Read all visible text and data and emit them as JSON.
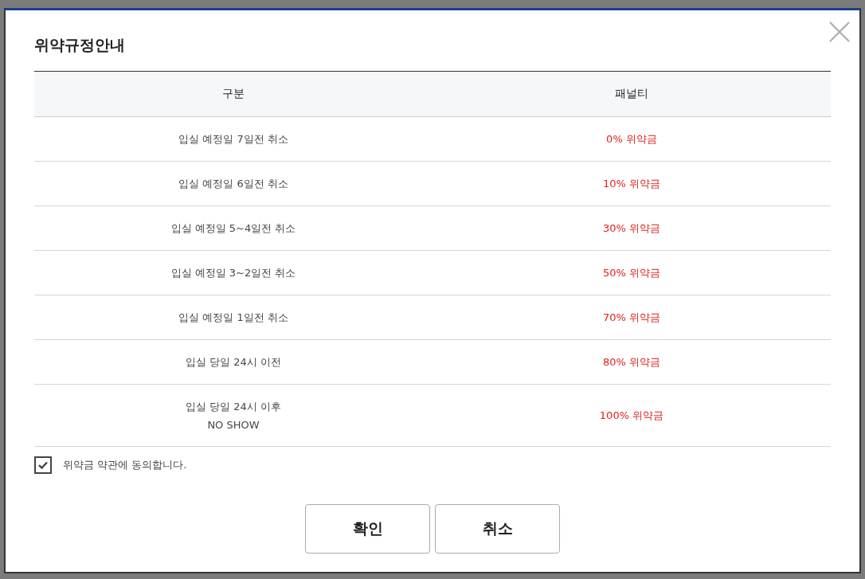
{
  "dialog": {
    "title": "위약규정안내"
  },
  "table": {
    "columns": [
      "구분",
      "패널티"
    ],
    "rows": [
      {
        "period": [
          "입실 예정일 7일전 취소"
        ],
        "penalty": "0% 위약금"
      },
      {
        "period": [
          "입실 예정일 6일전 취소"
        ],
        "penalty": "10% 위약금"
      },
      {
        "period": [
          "입실 예정일 5~4일전 취소"
        ],
        "penalty": "30% 위약금"
      },
      {
        "period": [
          "입실 예정일 3~2일전 취소"
        ],
        "penalty": "50% 위약금"
      },
      {
        "period": [
          "입실 예정일 1일전 취소"
        ],
        "penalty": "70% 위약금"
      },
      {
        "period": [
          "입실 당일 24시 이전"
        ],
        "penalty": "80% 위약금"
      },
      {
        "period": [
          "입실 당일 24시 이후",
          "NO SHOW"
        ],
        "penalty": "100% 위약금"
      }
    ]
  },
  "agreement": {
    "label": "위약금 약관에 동의합니다.",
    "checked": true
  },
  "buttons": [
    "확인",
    "취소"
  ]
}
